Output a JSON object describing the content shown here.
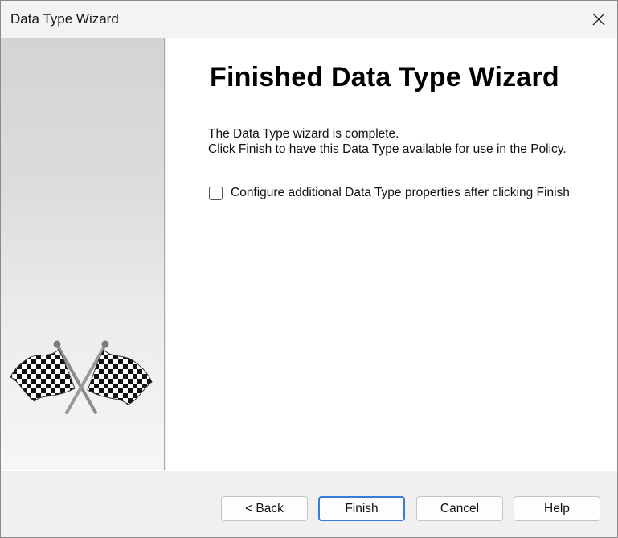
{
  "window": {
    "title": "Data Type Wizard"
  },
  "content": {
    "heading": "Finished Data Type Wizard",
    "description_line1": "The Data Type wizard is complete.",
    "description_line2": "Click Finish to have this Data Type available for use in the Policy.",
    "checkbox_label": "Configure additional Data Type properties after clicking Finish",
    "checkbox_checked": false
  },
  "buttons": {
    "back": "< Back",
    "finish": "Finish",
    "cancel": "Cancel",
    "help": "Help"
  },
  "icons": {
    "close": "close-icon",
    "illustration": "checkered-flags-icon"
  },
  "colors": {
    "default_button_border": "#3a7bd5"
  }
}
